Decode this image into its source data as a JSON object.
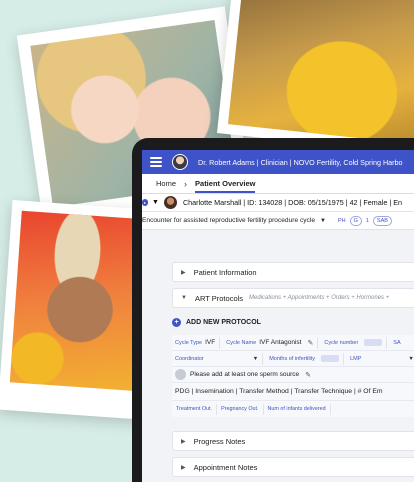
{
  "header": {
    "title": "Dr. Robert Adams | Clinician | NOVO Fertility, Cold Spring Harbo"
  },
  "tabs": {
    "home": "Home",
    "active": "Patient Overview"
  },
  "patient": {
    "info": "Charlotte Marshall | ID: 134028 | DOB: 05/15/1975 | 42 | Female | En",
    "badge": "▸"
  },
  "encounter": {
    "label": "Encounter for assisted reproductive fertility procedure cycle",
    "tags": [
      "PH",
      "G",
      "1",
      "SAB"
    ]
  },
  "sections": {
    "patient_information": "Patient Information",
    "art_protocols": "ART Protocols",
    "art_subtitle": "Medications + Appointments + Orders + Hormones +",
    "progress_notes": "Progress Notes",
    "appointment_notes": "Appointment Notes"
  },
  "protocol": {
    "add_label": "ADD NEW PROTOCOL",
    "cycle_type_label": "Cycle Type",
    "cycle_type_value": "IVF",
    "cycle_name_label": "Cycle Name",
    "cycle_name_value": "IVF Antagonist",
    "cycle_number_label": "Cycle number",
    "sa_label": "SA",
    "coordinator_label": "Coordinator",
    "months_infertility_label": "Months of infertility",
    "lmp_label": "LMP",
    "sperm_note": "Please add at least one sperm source",
    "methods": "PDG  |  Insemination  |  Transfer Method  |  Transfer Technique  |  # Of Em",
    "treatment_out": "Treatment Out.",
    "pregnancy_out": "Pregnancy Out.",
    "infants_delivered": "Num of infants delivered"
  },
  "icons": {
    "menu": "hamburger-icon",
    "expand": "chevron-icon",
    "edit": "pencil-icon",
    "add": "plus-circle-icon"
  },
  "colors": {
    "accent": "#3e53c7",
    "background": "#d6ece7"
  }
}
